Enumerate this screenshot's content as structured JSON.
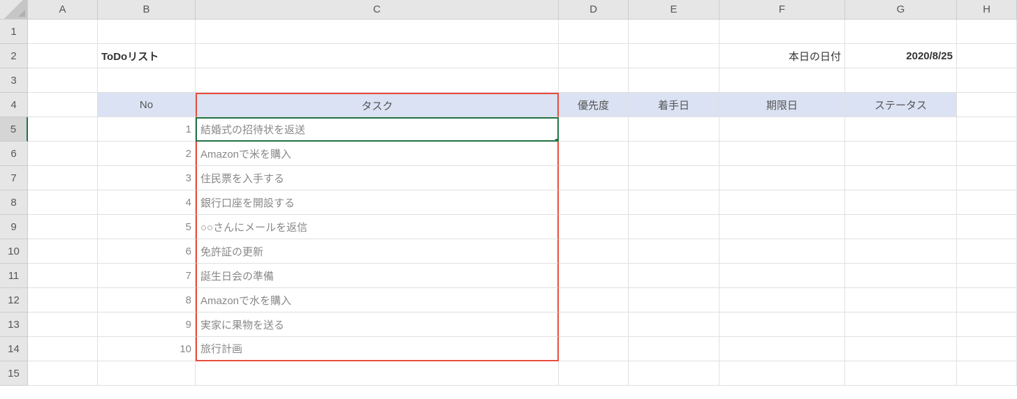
{
  "columns": [
    "A",
    "B",
    "C",
    "D",
    "E",
    "F",
    "G",
    "H"
  ],
  "rowNumbers": [
    1,
    2,
    3,
    4,
    5,
    6,
    7,
    8,
    9,
    10,
    11,
    12,
    13,
    14,
    15
  ],
  "activeRow": 5,
  "title": "ToDoリスト",
  "dateLabel": "本日の日付",
  "dateValue": "2020/8/25",
  "headers": {
    "no": "No",
    "task": "タスク",
    "priority": "優先度",
    "start": "着手日",
    "due": "期限日",
    "status": "ステータス"
  },
  "tasks": [
    {
      "no": 1,
      "task": "結婚式の招待状を返送"
    },
    {
      "no": 2,
      "task": "Amazonで米を購入"
    },
    {
      "no": 3,
      "task": "住民票を入手する"
    },
    {
      "no": 4,
      "task": "銀行口座を開設する"
    },
    {
      "no": 5,
      "task": "○○さんにメールを返信"
    },
    {
      "no": 6,
      "task": "免許証の更新"
    },
    {
      "no": 7,
      "task": "誕生日会の準備"
    },
    {
      "no": 8,
      "task": "Amazonで水を購入"
    },
    {
      "no": 9,
      "task": "実家に果物を送る"
    },
    {
      "no": 10,
      "task": "旅行計画"
    }
  ]
}
